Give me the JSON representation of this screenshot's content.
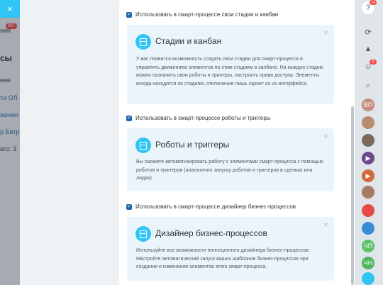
{
  "background": {
    "close_label": "×",
    "lines": [
      {
        "id": "line-1",
        "text": "нии",
        "top": 0
      },
      {
        "id": "line-2",
        "text": "сы",
        "top": 0
      },
      {
        "id": "line-3",
        "text": "ние",
        "top": 0
      },
      {
        "id": "line-4",
        "text": "ти ОЛ",
        "top": 0
      },
      {
        "id": "line-5",
        "text": "жения Б",
        "top": 0
      },
      {
        "id": "line-6",
        "text": "р Битри",
        "top": 0
      },
      {
        "id": "line-7",
        "text": "его: 3",
        "top": 0
      }
    ],
    "badge": "99+"
  },
  "settings": [
    {
      "checkbox_label": "Использовать в смарт-процессе свои стадии и канбан",
      "title": "Стадии и канбан",
      "text": "У вас появится возможность создать свои стадии для смарт-процесса и управлять движением элементов по этим стадиям в канбане. На каждую стадию можно назначить свои роботы и триггеры, настроить права доступа. Элементы всегда находятся по стадиям, отключение лишь скроет их из интерфейса."
    },
    {
      "checkbox_label": "Использовать в смарт-процессе роботы и триггеры",
      "title": "Роботы и триггеры",
      "text": "Вы сможете автоматизировать работу с элементами смарт-процесса с помощью роботов и триггеров (аналогично запуску роботов и триггеров в сделках или лидах)."
    },
    {
      "checkbox_label": "Использовать в смарт-процессе дизайнер бизнес-процессов",
      "title": "Дизайнер бизнес-процессов",
      "text": "Используйте все возможности полноценного дизайнера бизнес-процессов. Настройте автоматический запуск ваших шаблонов бизнес-процессов при создании и изменении элементов этого смарт-процесса."
    }
  ],
  "right_panel": {
    "help_badge": "14",
    "notif_badge": "5",
    "avatars": [
      {
        "name": "avatar-vp",
        "label": "ВП",
        "color": "#c58b7b"
      },
      {
        "name": "avatar-photo-1",
        "label": "",
        "color": "#b98a6e"
      },
      {
        "name": "avatar-photo-2",
        "label": "",
        "color": "#7a6a5e"
      },
      {
        "name": "avatar-play-1",
        "label": "▶",
        "color": "#6b4a8c"
      },
      {
        "name": "avatar-play-2",
        "label": "▶",
        "color": "#d06a3b"
      },
      {
        "name": "avatar-photo-3",
        "label": "",
        "color": "#a87b62"
      },
      {
        "name": "avatar-logo",
        "label": "",
        "color": "#e84a4a"
      },
      {
        "name": "avatar-globe",
        "label": "",
        "color": "#3a8bd6"
      },
      {
        "name": "avatar-chp",
        "label": "ЧП",
        "color": "#5cc16a"
      },
      {
        "name": "avatar-chn",
        "label": "ЧН",
        "color": "#4fb65f"
      },
      {
        "name": "avatar-photo-4",
        "label": "",
        "color": "#8a9b7e"
      },
      {
        "name": "avatar-bottom",
        "label": "",
        "color": "#2fc6f6"
      }
    ]
  }
}
